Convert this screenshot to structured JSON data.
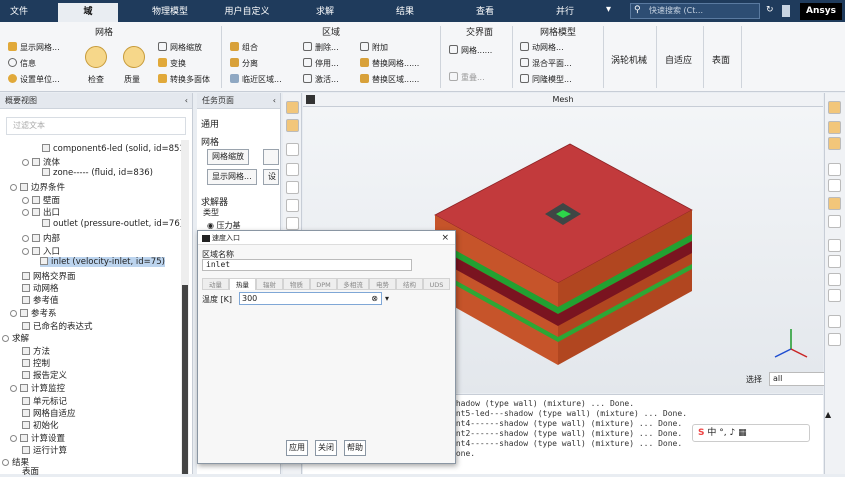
{
  "tabs": [
    "文件",
    "域",
    "物理模型",
    "用户自定义",
    "求解",
    "结果",
    "查看",
    "并行"
  ],
  "active_tab": "域",
  "search": {
    "placeholder": "快速搜索 (Ct..."
  },
  "brand": "Ansys",
  "ribbon": {
    "mesh": {
      "title": "网格",
      "display": "显示网格...",
      "info": "信息",
      "units": "设置单位...",
      "check": "检查",
      "quality": "质量",
      "scale": "网格缩放",
      "transform": "变换",
      "convert": "转换多面体"
    },
    "zones": {
      "title": "区域",
      "combine": "组合",
      "separate": "分离",
      "adjacency": "临近区域...",
      "delete": "删除...",
      "deactivate": "停用...",
      "activate": "激活...",
      "append": "附加",
      "replace_mesh": "替换网格......",
      "replace_zone": "替换区域......"
    },
    "interface": {
      "title": "交界面",
      "mesh": "网格......",
      "overlap": "重叠..."
    },
    "mesh_models": {
      "title": "网格模型",
      "dynamic": "动网格...",
      "mixing": "混合平面...",
      "periodic": "同隆模型..."
    },
    "turbo": "涡轮机械",
    "adapt": "自适应",
    "surface": "表面"
  },
  "outline": {
    "title": "概要视图",
    "filter_placeholder": "过滤文本",
    "items": [
      "component6-led (solid, id=851)",
      "流体",
      "zone----- (fluid, id=836)",
      "边界条件",
      "壁面",
      "出口",
      "outlet (pressure-outlet, id=76)",
      "内部",
      "入口",
      "inlet (velocity-inlet, id=75)",
      "网格交界面",
      "动网格",
      "参考值",
      "参考系",
      "已命名的表达式",
      "求解",
      "方法",
      "控制",
      "报告定义",
      "计算监控",
      "单元标记",
      "网格自适应",
      "初始化",
      "计算设置",
      "运行计算",
      "结果",
      "表面"
    ]
  },
  "task": {
    "title": "任务页面",
    "general": "通用",
    "mesh": "网格",
    "scale_btn": "网格缩放",
    "display_btn": "显示网格...",
    "setup_btn": "设",
    "solver": "求解器",
    "type": "类型",
    "pressure": "压力基"
  },
  "viewport": {
    "title": "Mesh"
  },
  "select": {
    "label": "选择",
    "value": "all"
  },
  "console": [
    "shadow (type wall) (mixture) ... Done.",
    "ent5-led---shadow (type wall) (mixture) ... Done.",
    "ent4------shadow (type wall) (mixture) ... Done.",
    "ent2------shadow (type wall) (mixture) ... Done.",
    "ent4------shadow (type wall) (mixture) ... Done.",
    "Done."
  ],
  "dialog": {
    "title": "速度入口",
    "zone_label": "区域名称",
    "zone_value": "inlet",
    "tabs": [
      "动量",
      "热量",
      "辐射",
      "物质",
      "DPM",
      "多相流",
      "电势",
      "结构",
      "UDS"
    ],
    "active_tab": "热量",
    "temp_label": "温度 [K]",
    "temp_value": "300",
    "apply": "应用",
    "close": "关闭",
    "help": "帮助"
  },
  "ime": [
    "中",
    "°,"
  ]
}
